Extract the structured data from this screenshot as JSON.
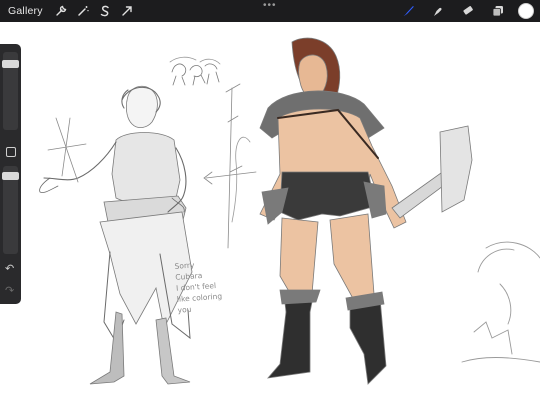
{
  "topbar": {
    "gallery_label": "Gallery",
    "left_icons": [
      "wrench-icon",
      "magic-wand-icon",
      "s-selection-icon",
      "arrow-transform-icon"
    ],
    "right_icons": [
      "brush-icon",
      "smudge-icon",
      "eraser-icon",
      "layers-icon"
    ],
    "active_tool": "brush-icon",
    "brush_color": "#2f5dff",
    "current_color": "#ffffff"
  },
  "sidebar": {
    "brush_size_level": 0.85,
    "opacity_level": 0.75,
    "icons": [
      "brush-size-slider",
      "modify-square-icon",
      "opacity-slider",
      "undo-icon",
      "redo-icon"
    ]
  },
  "canvas": {
    "note_text": "Sorry\nCubara\nI don't feel\nlike coloring\nyou"
  }
}
